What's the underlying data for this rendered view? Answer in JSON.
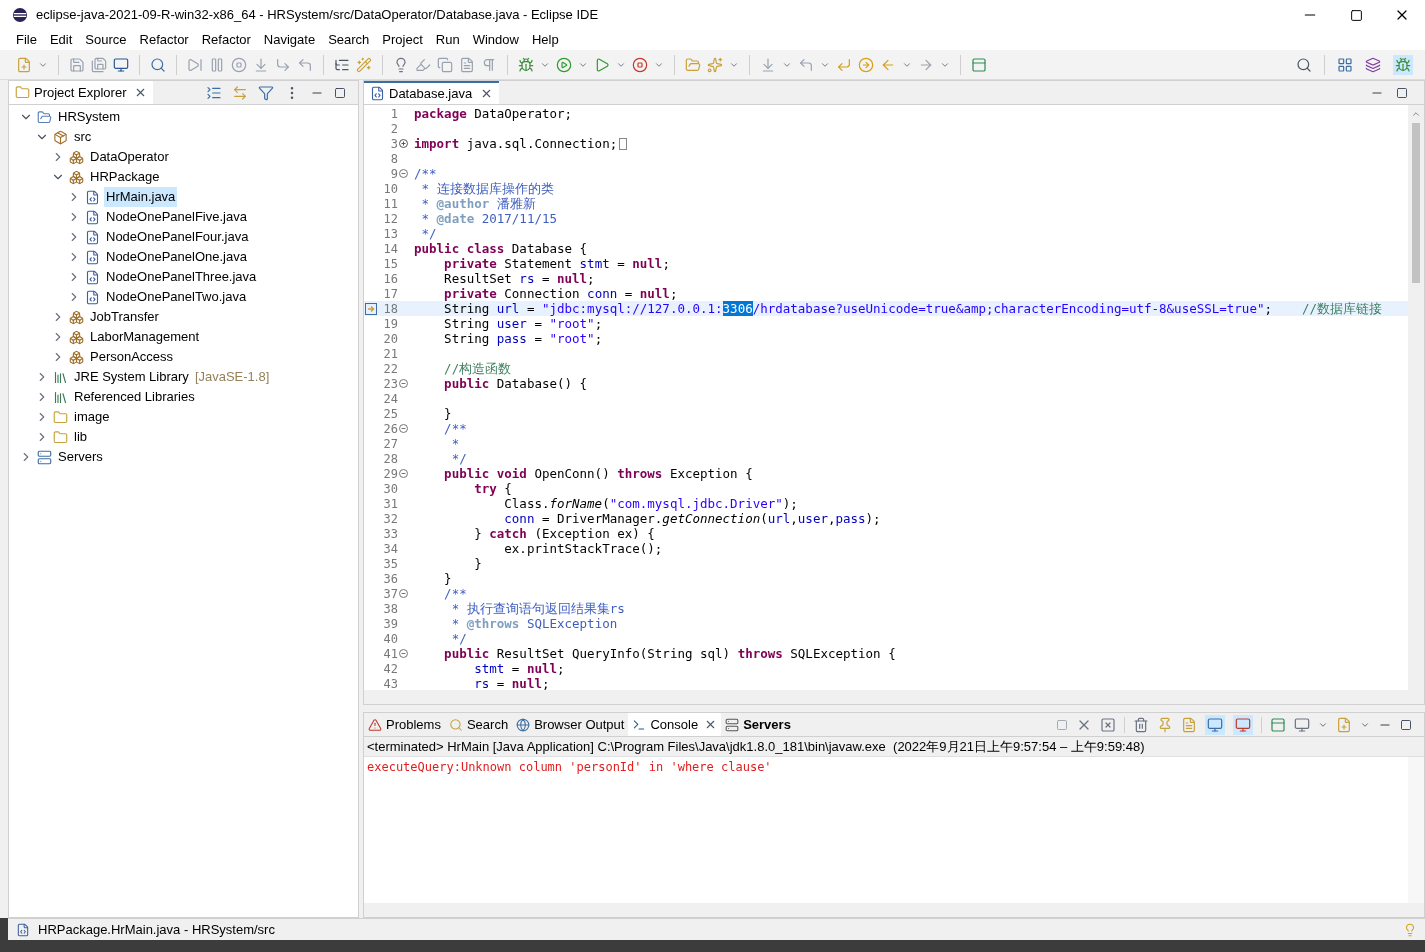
{
  "window": {
    "title": "eclipse-java-2021-09-R-win32-x86_64 - HRSystem/src/DataOperator/Database.java - Eclipse IDE"
  },
  "menu": [
    "File",
    "Edit",
    "Source",
    "Refactor",
    "Refactor",
    "Navigate",
    "Search",
    "Project",
    "Run",
    "Window",
    "Help"
  ],
  "project_explorer": {
    "title": "Project Explorer",
    "tree": [
      {
        "label": "HRSystem",
        "kind": "project",
        "expanded": true,
        "selected": false,
        "children": [
          {
            "label": "src",
            "kind": "source",
            "expanded": true,
            "selected": false,
            "children": [
              {
                "label": "DataOperator",
                "kind": "package",
                "expanded": false,
                "selected": false
              },
              {
                "label": "HRPackage",
                "kind": "package",
                "expanded": true,
                "selected": false,
                "children": [
                  {
                    "label": "HrMain.java",
                    "kind": "java",
                    "expanded": false,
                    "selected": true
                  },
                  {
                    "label": "NodeOnePanelFive.java",
                    "kind": "java",
                    "expanded": false,
                    "selected": false
                  },
                  {
                    "label": "NodeOnePanelFour.java",
                    "kind": "java",
                    "expanded": false,
                    "selected": false
                  },
                  {
                    "label": "NodeOnePanelOne.java",
                    "kind": "java",
                    "expanded": false,
                    "selected": false
                  },
                  {
                    "label": "NodeOnePanelThree.java",
                    "kind": "java",
                    "expanded": false,
                    "selected": false
                  },
                  {
                    "label": "NodeOnePanelTwo.java",
                    "kind": "java",
                    "expanded": false,
                    "selected": false
                  }
                ]
              },
              {
                "label": "JobTransfer",
                "kind": "package",
                "expanded": false,
                "selected": false
              },
              {
                "label": "LaborManagement",
                "kind": "package",
                "expanded": false,
                "selected": false
              },
              {
                "label": "PersonAccess",
                "kind": "package",
                "expanded": false,
                "selected": false
              }
            ]
          },
          {
            "label": "JRE System Library",
            "decoration": "[JavaSE-1.8]",
            "kind": "library",
            "expanded": false,
            "selected": false
          },
          {
            "label": "Referenced Libraries",
            "kind": "library",
            "expanded": false,
            "selected": false
          },
          {
            "label": "image",
            "kind": "folder",
            "expanded": false,
            "selected": false
          },
          {
            "label": "lib",
            "kind": "folder",
            "expanded": false,
            "selected": false
          }
        ]
      },
      {
        "label": "Servers",
        "kind": "servers",
        "expanded": false,
        "selected": false
      }
    ]
  },
  "editor": {
    "tab": "Database.java",
    "lines": [
      {
        "n": "1",
        "kind": "plain",
        "current": false,
        "tokens": [
          {
            "kind": "kw",
            "text": "package"
          },
          {
            "kind": "p",
            "text": " DataOperator;"
          }
        ]
      },
      {
        "n": "2",
        "kind": "plain",
        "current": false
      },
      {
        "n": "3",
        "kind": "expand",
        "current": false,
        "tokens": [
          {
            "kind": "kw",
            "text": "import"
          },
          {
            "kind": "p",
            "text": " java.sql.Connection;"
          }
        ]
      },
      {
        "n": "8",
        "kind": "plain",
        "current": false
      },
      {
        "n": "9",
        "kind": "collapse",
        "current": false,
        "tokens": [
          {
            "kind": "doc",
            "text": "/**"
          }
        ]
      },
      {
        "n": "10",
        "kind": "plain",
        "current": false,
        "tokens": [
          {
            "kind": "doc",
            "text": " * 连接数据库操作的类"
          }
        ]
      },
      {
        "n": "11",
        "kind": "plain",
        "current": false,
        "tokens": [
          {
            "kind": "doc",
            "text": " * "
          },
          {
            "kind": "tag",
            "text": "@author"
          },
          {
            "kind": "doc",
            "text": " 潘雅新"
          }
        ]
      },
      {
        "n": "12",
        "kind": "plain",
        "current": false,
        "tokens": [
          {
            "kind": "doc",
            "text": " * "
          },
          {
            "kind": "tag",
            "text": "@date"
          },
          {
            "kind": "doc",
            "text": " 2017/11/15"
          }
        ]
      },
      {
        "n": "13",
        "kind": "plain",
        "current": false,
        "tokens": [
          {
            "kind": "doc",
            "text": " */"
          }
        ]
      },
      {
        "n": "14",
        "kind": "plain",
        "current": false,
        "tokens": [
          {
            "kind": "kw",
            "text": "public class"
          },
          {
            "kind": "p",
            "text": " Database {"
          }
        ]
      },
      {
        "n": "15",
        "kind": "plain",
        "current": false,
        "tokens": [
          {
            "kind": "kw",
            "text": "    private"
          },
          {
            "kind": "p",
            "text": " Statement "
          },
          {
            "kind": "field",
            "text": "stmt"
          },
          {
            "kind": "p",
            "text": " = "
          },
          {
            "kind": "kw",
            "text": "null"
          },
          {
            "kind": "p",
            "text": ";"
          }
        ]
      },
      {
        "n": "16",
        "kind": "plain",
        "current": false,
        "tokens": [
          {
            "kind": "p",
            "text": "    ResultSet "
          },
          {
            "kind": "field",
            "text": "rs"
          },
          {
            "kind": "p",
            "text": " = "
          },
          {
            "kind": "kw",
            "text": "null"
          },
          {
            "kind": "p",
            "text": ";"
          }
        ]
      },
      {
        "n": "17",
        "kind": "plain",
        "current": false,
        "tokens": [
          {
            "kind": "kw",
            "text": "    private"
          },
          {
            "kind": "p",
            "text": " Connection "
          },
          {
            "kind": "field",
            "text": "conn"
          },
          {
            "kind": "p",
            "text": " = "
          },
          {
            "kind": "kw",
            "text": "null"
          },
          {
            "kind": "p",
            "text": ";"
          }
        ]
      },
      {
        "n": "18",
        "kind": "plain",
        "current": true,
        "tokens": [
          {
            "kind": "p",
            "text": "    String "
          },
          {
            "kind": "field",
            "text": "url"
          },
          {
            "kind": "p",
            "text": " = "
          },
          {
            "kind": "str",
            "text": "\"jdbc:mysql://127.0.0.1:"
          },
          {
            "kind": "sel",
            "text": "3306"
          },
          {
            "kind": "str",
            "text": "/hrdatabase?useUnicode=true&amp;characterEncoding=utf-8&useSSL=true\""
          },
          {
            "kind": "p",
            "text": ";    "
          },
          {
            "kind": "cm",
            "text": "//数据库链接"
          }
        ]
      },
      {
        "n": "19",
        "kind": "plain",
        "current": false,
        "tokens": [
          {
            "kind": "p",
            "text": "    String "
          },
          {
            "kind": "field",
            "text": "user"
          },
          {
            "kind": "p",
            "text": " = "
          },
          {
            "kind": "str",
            "text": "\"root\""
          },
          {
            "kind": "p",
            "text": ";"
          }
        ]
      },
      {
        "n": "20",
        "kind": "plain",
        "current": false,
        "tokens": [
          {
            "kind": "p",
            "text": "    String "
          },
          {
            "kind": "field",
            "text": "pass"
          },
          {
            "kind": "p",
            "text": " = "
          },
          {
            "kind": "str",
            "text": "\"root\""
          },
          {
            "kind": "p",
            "text": ";"
          }
        ]
      },
      {
        "n": "21",
        "kind": "plain",
        "current": false
      },
      {
        "n": "22",
        "kind": "plain",
        "current": false,
        "tokens": [
          {
            "kind": "cm",
            "text": "    //构造函数"
          }
        ]
      },
      {
        "n": "23",
        "kind": "collapse",
        "current": false,
        "tokens": [
          {
            "kind": "kw",
            "text": "    public"
          },
          {
            "kind": "p",
            "text": " Database() {"
          }
        ]
      },
      {
        "n": "24",
        "kind": "plain",
        "current": false
      },
      {
        "n": "25",
        "kind": "plain",
        "current": false,
        "tokens": [
          {
            "kind": "p",
            "text": "    }"
          }
        ]
      },
      {
        "n": "26",
        "kind": "collapse",
        "current": false,
        "tokens": [
          {
            "kind": "doc",
            "text": "    /**"
          }
        ]
      },
      {
        "n": "27",
        "kind": "plain",
        "current": false,
        "tokens": [
          {
            "kind": "doc",
            "text": "     *"
          }
        ]
      },
      {
        "n": "28",
        "kind": "plain",
        "current": false,
        "tokens": [
          {
            "kind": "doc",
            "text": "     */"
          }
        ]
      },
      {
        "n": "29",
        "kind": "collapse",
        "current": false,
        "tokens": [
          {
            "kind": "kw",
            "text": "    public void"
          },
          {
            "kind": "p",
            "text": " OpenConn() "
          },
          {
            "kind": "kw",
            "text": "throws"
          },
          {
            "kind": "p",
            "text": " Exception {"
          }
        ]
      },
      {
        "n": "30",
        "kind": "plain",
        "current": false,
        "tokens": [
          {
            "kind": "kw",
            "text": "        try"
          },
          {
            "kind": "p",
            "text": " {"
          }
        ]
      },
      {
        "n": "31",
        "kind": "plain",
        "current": false,
        "tokens": [
          {
            "kind": "p",
            "text": "            Class."
          },
          {
            "kind": "static",
            "text": "forName"
          },
          {
            "kind": "p",
            "text": "("
          },
          {
            "kind": "str",
            "text": "\"com.mysql.jdbc.Driver\""
          },
          {
            "kind": "p",
            "text": ");"
          }
        ]
      },
      {
        "n": "32",
        "kind": "plain",
        "current": false,
        "tokens": [
          {
            "kind": "field",
            "text": "            conn"
          },
          {
            "kind": "p",
            "text": " = DriverManager."
          },
          {
            "kind": "static",
            "text": "getConnection"
          },
          {
            "kind": "p",
            "text": "("
          },
          {
            "kind": "field",
            "text": "url"
          },
          {
            "kind": "p",
            "text": ","
          },
          {
            "kind": "field",
            "text": "user"
          },
          {
            "kind": "p",
            "text": ","
          },
          {
            "kind": "field",
            "text": "pass"
          },
          {
            "kind": "p",
            "text": ");"
          }
        ]
      },
      {
        "n": "33",
        "kind": "plain",
        "current": false,
        "tokens": [
          {
            "kind": "p",
            "text": "        } "
          },
          {
            "kind": "kw",
            "text": "catch"
          },
          {
            "kind": "p",
            "text": " (Exception ex) {"
          }
        ]
      },
      {
        "n": "34",
        "kind": "plain",
        "current": false,
        "tokens": [
          {
            "kind": "p",
            "text": "            ex.printStackTrace();"
          }
        ]
      },
      {
        "n": "35",
        "kind": "plain",
        "current": false,
        "tokens": [
          {
            "kind": "p",
            "text": "        }"
          }
        ]
      },
      {
        "n": "36",
        "kind": "plain",
        "current": false,
        "tokens": [
          {
            "kind": "p",
            "text": "    }"
          }
        ]
      },
      {
        "n": "37",
        "kind": "collapse",
        "current": false,
        "tokens": [
          {
            "kind": "doc",
            "text": "    /**"
          }
        ]
      },
      {
        "n": "38",
        "kind": "plain",
        "current": false,
        "tokens": [
          {
            "kind": "doc",
            "text": "     * 执行查询语句返回结果集rs"
          }
        ]
      },
      {
        "n": "39",
        "kind": "plain",
        "current": false,
        "tokens": [
          {
            "kind": "doc",
            "text": "     * "
          },
          {
            "kind": "tag",
            "text": "@throws"
          },
          {
            "kind": "doc",
            "text": " SQLException"
          }
        ]
      },
      {
        "n": "40",
        "kind": "plain",
        "current": false,
        "tokens": [
          {
            "kind": "doc",
            "text": "     */"
          }
        ]
      },
      {
        "n": "41",
        "kind": "collapse",
        "current": false,
        "tokens": [
          {
            "kind": "kw",
            "text": "    public"
          },
          {
            "kind": "p",
            "text": " ResultSet QueryInfo(String sql) "
          },
          {
            "kind": "kw",
            "text": "throws"
          },
          {
            "kind": "p",
            "text": " SQLException {"
          }
        ]
      },
      {
        "n": "42",
        "kind": "plain",
        "current": false,
        "tokens": [
          {
            "kind": "field",
            "text": "        stmt"
          },
          {
            "kind": "p",
            "text": " = "
          },
          {
            "kind": "kw",
            "text": "null"
          },
          {
            "kind": "p",
            "text": ";"
          }
        ]
      },
      {
        "n": "43",
        "kind": "plain",
        "current": false,
        "tokens": [
          {
            "kind": "field",
            "text": "        rs"
          },
          {
            "kind": "p",
            "text": " = "
          },
          {
            "kind": "kw",
            "text": "null"
          },
          {
            "kind": "p",
            "text": ";"
          }
        ]
      }
    ]
  },
  "console": {
    "tabs": [
      {
        "label": "Problems",
        "kind": "problems",
        "selected": false,
        "bold": false
      },
      {
        "label": "Search",
        "kind": "search",
        "selected": false,
        "bold": false
      },
      {
        "label": "Browser Output",
        "kind": "browser",
        "selected": false,
        "bold": false
      },
      {
        "label": "Console",
        "kind": "console",
        "selected": true,
        "bold": false
      },
      {
        "label": "Servers",
        "kind": "servers",
        "selected": false,
        "bold": true
      }
    ],
    "header": "<terminated> HrMain [Java Application] C:\\Program Files\\Java\\jdk1.8.0_181\\bin\\javaw.exe  (2022年9月21日上午9:57:54 – 上午9:59:48)",
    "output": [
      {
        "text": "executeQuery:Unknown column 'personId' in 'where clause'",
        "kind": "error"
      }
    ]
  },
  "status_bar": {
    "text": "HRPackage.HrMain.java - HRSystem/src"
  }
}
